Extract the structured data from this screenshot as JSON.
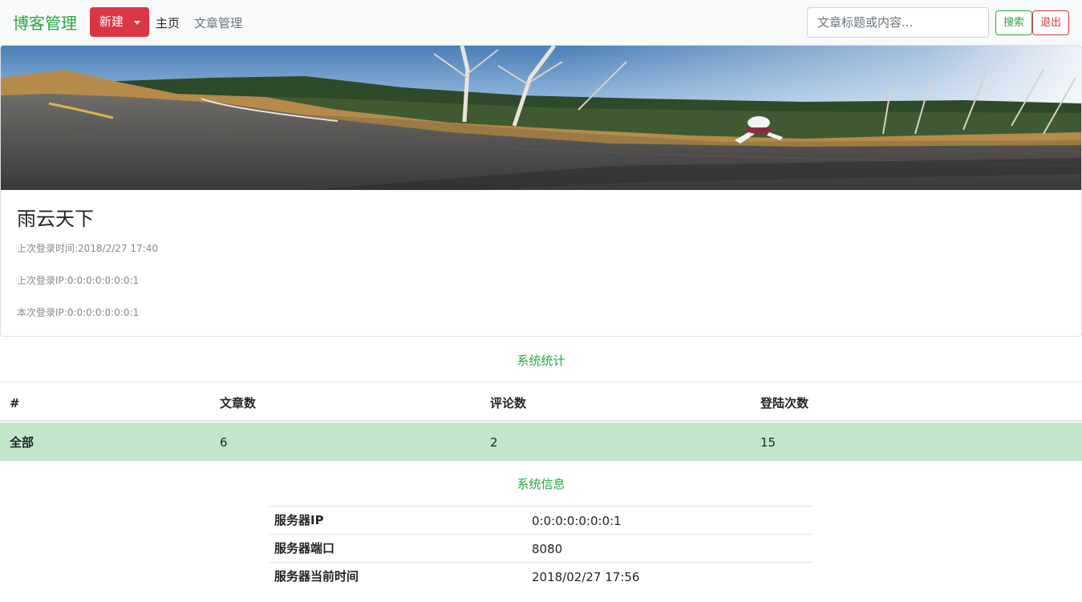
{
  "navbar": {
    "brand": "博客管理",
    "new_button": "新建",
    "home_link": "主页",
    "articles_link": "文章管理",
    "search_placeholder": "文章标题或内容...",
    "search_button": "搜索",
    "logout_button": "退出"
  },
  "profile": {
    "name": "雨云天下",
    "last_login_time": "上次登录时间:2018/2/27 17:40",
    "last_login_ip": "上次登录IP:0:0:0:0:0:0:0:1",
    "current_login_ip": "本次登录IP:0:0:0:0:0:0:0:1"
  },
  "stats": {
    "title": "系统统计",
    "headers": [
      "#",
      "文章数",
      "评论数",
      "登陆次数"
    ],
    "row": [
      "全部",
      "6",
      "2",
      "15"
    ]
  },
  "info": {
    "title": "系统信息",
    "rows": [
      {
        "key": "服务器IP",
        "value": "0:0:0:0:0:0:0:1"
      },
      {
        "key": "服务器端口",
        "value": "8080"
      },
      {
        "key": "服务器当前时间",
        "value": "2018/02/27 17:56"
      }
    ]
  },
  "colors": {
    "brand_green": "#28a745",
    "danger_red": "#dc3545",
    "success_row": "#c3e6cb"
  }
}
